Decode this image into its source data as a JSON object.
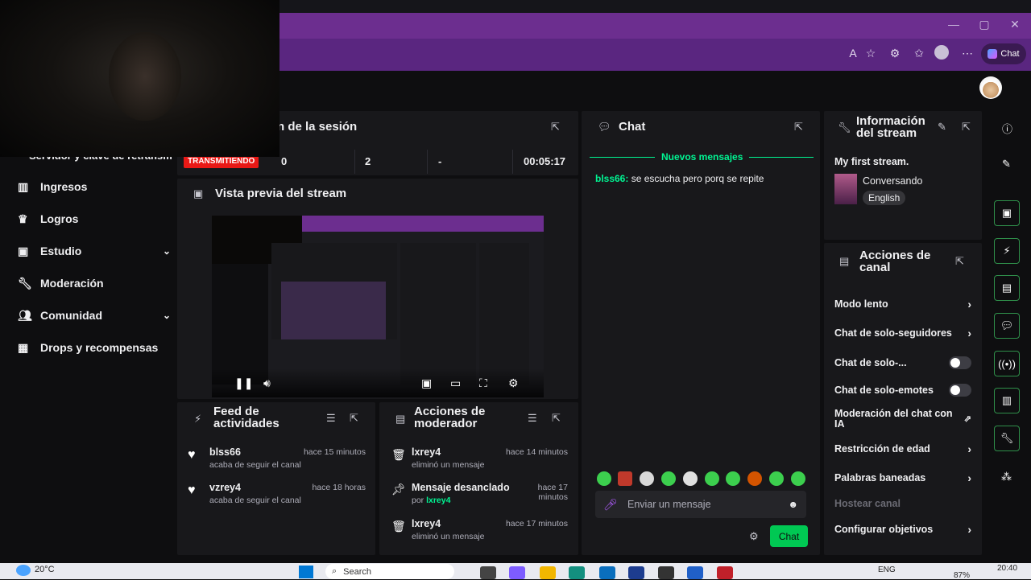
{
  "browser": {
    "chat_label": "Chat"
  },
  "sidebar": {
    "cut_text": "Servidor y clave de retransm",
    "items": [
      {
        "label": "Ingresos",
        "icon": "bar-chart-icon"
      },
      {
        "label": "Logros",
        "icon": "trophy-icon"
      },
      {
        "label": "Estudio",
        "icon": "video-icon"
      },
      {
        "label": "Moderación",
        "icon": "wrench-icon"
      },
      {
        "label": "Comunidad",
        "icon": "people-icon"
      },
      {
        "label": "Drops y recompensas",
        "icon": "gift-icon"
      }
    ]
  },
  "session": {
    "title": "n de la sesión",
    "status": "TRANSMITIENDO",
    "stats": [
      "0",
      "2",
      "-",
      "00:05:17"
    ]
  },
  "preview": {
    "title": "Vista previa del stream"
  },
  "activity": {
    "title_line1": "Feed de",
    "title_line2": "actividades",
    "items": [
      {
        "user": "blss66",
        "time": "hace 15 minutos",
        "action": "acaba de seguir el canal"
      },
      {
        "user": "vzrey4",
        "time": "hace 18 horas",
        "action": "acaba de seguir el canal"
      }
    ]
  },
  "modactions": {
    "title_line1": "Acciones de",
    "title_line2": "moderador",
    "items": [
      {
        "title": "lxrey4",
        "time": "hace 14 minutos",
        "sub": "eliminó un mensaje"
      },
      {
        "title": "Mensaje desanclado",
        "time": "hace 17 minutos",
        "sub_prefix": "por ",
        "sub_user": "lxrey4"
      },
      {
        "title": "lxrey4",
        "time": "hace 17 minutos",
        "sub": "eliminó un mensaje"
      }
    ]
  },
  "chat": {
    "title": "Chat",
    "divider": "Nuevos mensajes",
    "message_user": "blss66:",
    "message_text": " se escucha pero porq se repite",
    "placeholder": "Enviar un mensaje",
    "send_label": "Chat"
  },
  "streaminfo": {
    "title_line1": "Información",
    "title_line2": "del stream",
    "stream_title": "My first stream.",
    "category": "Conversando",
    "language": "English"
  },
  "channelactions": {
    "title_line1": "Acciones de",
    "title_line2": "canal",
    "items": [
      {
        "label": "Modo lento",
        "control": "chevron"
      },
      {
        "label": "Chat de solo-seguidores",
        "control": "chevron"
      },
      {
        "label": "Chat de solo-...",
        "control": "toggle"
      },
      {
        "label": "Chat de solo-emotes",
        "control": "toggle"
      },
      {
        "label": "Moderación del chat con IA",
        "control": "external"
      },
      {
        "label": "Restricción de edad",
        "control": "chevron"
      },
      {
        "label": "Palabras baneadas",
        "control": "chevron"
      },
      {
        "label": "Hostear canal",
        "control": "none"
      },
      {
        "label": "Configurar objetivos",
        "control": "chevron"
      }
    ]
  },
  "taskbar": {
    "weather": "20°C",
    "search": "Search",
    "lang": "ENG",
    "battery": "87%",
    "time": "20:40"
  },
  "colors": {
    "accent": "#00f593",
    "brand": "#9147ff",
    "live": "#e91916"
  }
}
